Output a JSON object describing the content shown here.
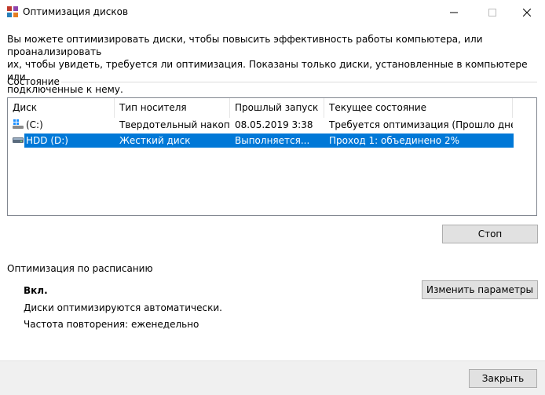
{
  "window": {
    "title": "Оптимизация дисков",
    "minimize_glyph": "—",
    "maximize_glyph": "☐",
    "close_glyph": "✕"
  },
  "description": "Вы можете оптимизировать диски, чтобы повысить эффективность работы  компьютера, или проанализировать\nих, чтобы увидеть, требуется ли оптимизация. Показаны только диски, установленные в компьютере или\nподключенные к нему.",
  "status_section": {
    "label": "Состояние",
    "columns": [
      "Диск",
      "Тип носителя",
      "Прошлый запуск",
      "Текущее состояние"
    ],
    "rows": [
      {
        "drive": "(C:)",
        "media_type": "Твердотельный накоп...",
        "last_run": "08.05.2019 3:38",
        "status": "Требуется оптимизация (Прошло дней ...",
        "icon": "windows-drive-icon",
        "selected": false
      },
      {
        "drive": "HDD (D:)",
        "media_type": "Жесткий диск",
        "last_run": "Выполняется...",
        "status": "Проход 1: объединено 2%",
        "icon": "hard-drive-icon",
        "selected": true
      }
    ],
    "stop_button": "Стоп"
  },
  "schedule": {
    "label": "Оптимизация по расписанию",
    "state": "Вкл.",
    "auto_text": "Диски оптимизируются автоматически.",
    "frequency": "Частота повторения: еженедельно",
    "change_button": "Изменить параметры"
  },
  "footer": {
    "close_button": "Закрыть"
  },
  "colors": {
    "selection": "#0078d7",
    "button_bg": "#e1e1e1",
    "footer_bg": "#f0f0f0"
  }
}
